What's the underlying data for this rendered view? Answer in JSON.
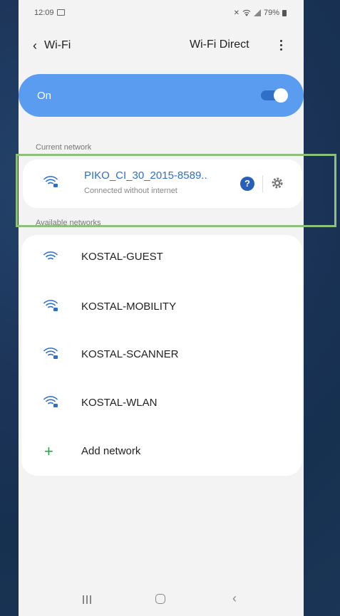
{
  "status_bar": {
    "time": "12:09",
    "battery": "79%"
  },
  "header": {
    "back_label": "Wi-Fi",
    "wifi_direct_label": "Wi-Fi Direct"
  },
  "master_toggle": {
    "label": "On",
    "state": "on"
  },
  "current_network": {
    "section_label": "Current network",
    "ssid": "PIKO_CI_30_2015-8589..",
    "status": "Connected without internet"
  },
  "available_networks": {
    "section_label": "Available networks",
    "items": [
      {
        "ssid": "KOSTAL-GUEST",
        "icon": "wifi-open-icon"
      },
      {
        "ssid": "KOSTAL-MOBILITY",
        "icon": "wifi-lock-icon"
      },
      {
        "ssid": "KOSTAL-SCANNER",
        "icon": "wifi-lock-icon"
      },
      {
        "ssid": "KOSTAL-WLAN",
        "icon": "wifi-lock-icon"
      }
    ],
    "add_network_label": "Add network"
  },
  "colors": {
    "accent": "#5a9cf0",
    "link": "#2f6fcc",
    "highlight": "#8dc07a",
    "add": "#27a146"
  }
}
